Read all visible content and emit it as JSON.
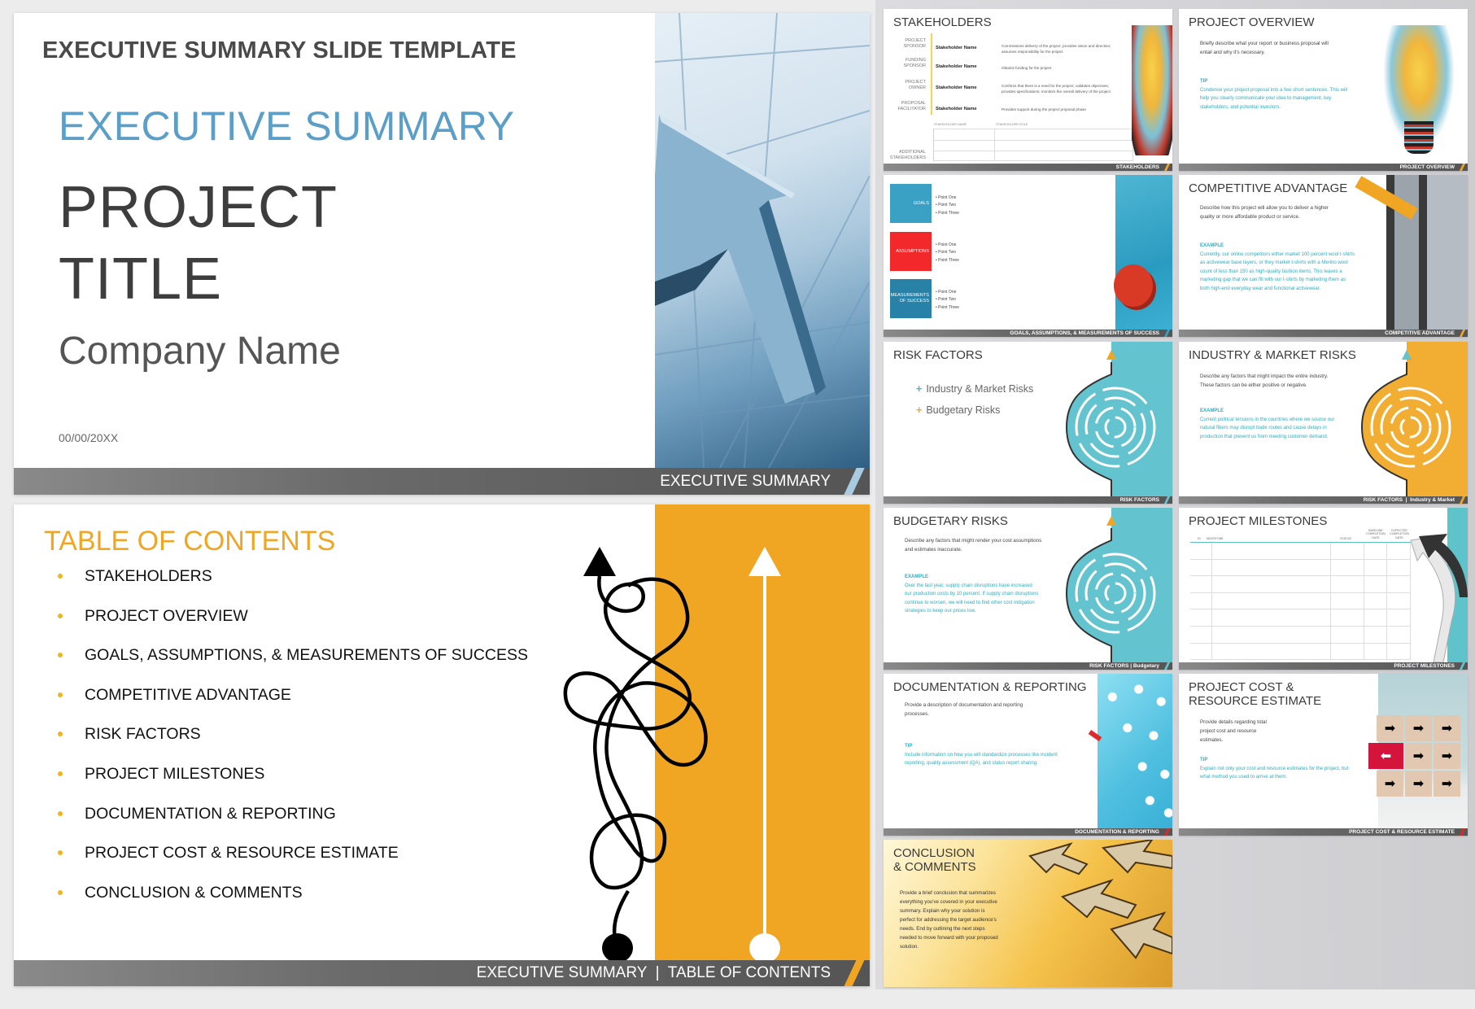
{
  "title_slide": {
    "template_heading": "EXECUTIVE SUMMARY SLIDE TEMPLATE",
    "subtitle": "EXECUTIVE SUMMARY",
    "project_title_line1": "PROJECT",
    "project_title_line2": "TITLE",
    "company_name": "Company Name",
    "date": "00/00/20XX",
    "footer": "EXECUTIVE SUMMARY",
    "accent": "#5b9ec7"
  },
  "toc_slide": {
    "title": "TABLE OF CONTENTS",
    "items": [
      "STAKEHOLDERS",
      "PROJECT OVERVIEW",
      "GOALS, ASSUMPTIONS, & MEASUREMENTS OF SUCCESS",
      "COMPETITIVE ADVANTAGE",
      "RISK FACTORS",
      "PROJECT MILESTONES",
      "DOCUMENTATION & REPORTING",
      "PROJECT COST & RESOURCE ESTIMATE",
      "CONCLUSION & COMMENTS"
    ],
    "footer": "EXECUTIVE SUMMARY  |  TABLE OF CONTENTS",
    "accent": "#f0a623"
  },
  "thumbnails": {
    "stakeholders": {
      "title": "STAKEHOLDERS",
      "rows": [
        {
          "label": "PROJECT SPONSOR",
          "name": "Stakeholder Name",
          "role": "Commissions delivery of the project; provides vision and direction; assumes responsibility for the project"
        },
        {
          "label": "FUNDING SPONSOR",
          "name": "Stakeholder Name",
          "role": "Obtains funding for the project"
        },
        {
          "label": "PROJECT OWNER",
          "name": "Stakeholder Name",
          "role": "Confirms that there is a need for the project; validates objectives; provides specifications; monitors the overall delivery of the project"
        },
        {
          "label": "PROPOSAL FACILITATOR",
          "name": "Stakeholder Name",
          "role": "Provides support during the project proposal phase"
        }
      ],
      "table_headers": [
        "STAKEHOLDER NAME",
        "STAKEHOLDER ROLE"
      ],
      "additional_label": "ADDITIONAL STAKEHOLDERS",
      "footer": "STAKEHOLDERS"
    },
    "project_overview": {
      "title": "PROJECT OVERVIEW",
      "body": "Briefly describe what your report or business proposal will entail and why it's necessary.",
      "tip_label": "TIP",
      "tip": "Condense your project proposal into a few short sentences. This will help you clearly communicate your idea to management, key stakeholders, and potential investors.",
      "footer": "PROJECT OVERVIEW"
    },
    "goals": {
      "boxes": [
        {
          "label": "GOALS",
          "color": "#3aa1c5",
          "points": [
            "Point One",
            "Point Two",
            "Point Three"
          ]
        },
        {
          "label": "ASSUMPTIONS",
          "color": "#f3282b",
          "points": [
            "Point One",
            "Point Two",
            "Point Three"
          ]
        },
        {
          "label": "MEASUREMENTS OF SUCCESS",
          "color": "#2881a6",
          "points": [
            "Point One",
            "Point Two",
            "Point Three"
          ]
        }
      ],
      "footer": "GOALS, ASSUMPTIONS, & MEASUREMENTS OF SUCCESS"
    },
    "competitive_advantage": {
      "title": "COMPETITIVE ADVANTAGE",
      "body": "Describe how this project will allow you to deliver a higher quality or more affordable product or service.",
      "example_label": "EXAMPLE",
      "example": "Currently, our online competitors either market 100 percent wool t-shirts as activewear base layers, or they market t-shirts with a Merino wool count of less than 150 as high-quality fashion items. This leaves a marketing gap that we can fill with our t-shirts by marketing them as both high-end everyday wear and functional activewear.",
      "footer": "COMPETITIVE ADVANTAGE"
    },
    "risk_factors": {
      "title": "RISK FACTORS",
      "items": [
        {
          "label": "Industry & Market Risks",
          "color": "#45b8c8"
        },
        {
          "label": "Budgetary Risks",
          "color": "#f0a623"
        }
      ],
      "footer": "RISK FACTORS"
    },
    "industry_market_risks": {
      "title": "INDUSTRY & MARKET RISKS",
      "body": "Describe any factors that might impact the entire industry. These factors can be either positive or negative.",
      "example_label": "EXAMPLE",
      "example": "Current political tensions in the countries where we source our natural fibers may disrupt trade routes and cause delays in production that prevent us from meeting customer demand.",
      "footer": "RISK FACTORS  |  Industry & Market"
    },
    "budgetary_risks": {
      "title": "BUDGETARY RISKS",
      "body": "Describe any factors that might render your cost assumptions and estimates inaccurate.",
      "example_label": "EXAMPLE",
      "example": "Over the last year, supply chain disruptions have increased our production costs by 10 percent. If supply chain disruptions continue to worsen, we will need to find other cost mitigation strategies to keep our prices low.",
      "footer": "RISK FACTORS | Budgetary"
    },
    "project_milestones": {
      "title": "PROJECT MILESTONES",
      "columns": [
        "ID",
        "MILESTONE",
        "STATUS",
        "BASELINE COMPLETION DATE",
        "EXPECTED COMPLETION DATE"
      ],
      "footer": "PROJECT MILESTONES"
    },
    "documentation_reporting": {
      "title": "DOCUMENTATION & REPORTING",
      "body": "Provide a description of documentation and reporting processes.",
      "tip_label": "TIP",
      "tip": "Include information on how you will standardize processes like incident reporting, quality assessment (QA), and status report sharing.",
      "footer": "DOCUMENTATION & REPORTING"
    },
    "project_cost": {
      "title_line1": "PROJECT COST &",
      "title_line2": "RESOURCE ESTIMATE",
      "body": "Provide details regarding total project cost and resource estimates.",
      "tip_label": "TIP",
      "tip": "Explain not only your cost and resource estimates for the project, but what method you used to arrive at them.",
      "footer": "PROJECT COST & RESOURCE ESTIMATE"
    },
    "conclusion": {
      "title_line1": "CONCLUSION",
      "title_line2": "& COMMENTS",
      "body": "Provide a brief conclusion that summarizes everything you've covered in your executive summary. Explain why your solution is perfect for addressing the target audience's needs. End by outlining the next steps needed to move forward with your proposed solution."
    }
  }
}
